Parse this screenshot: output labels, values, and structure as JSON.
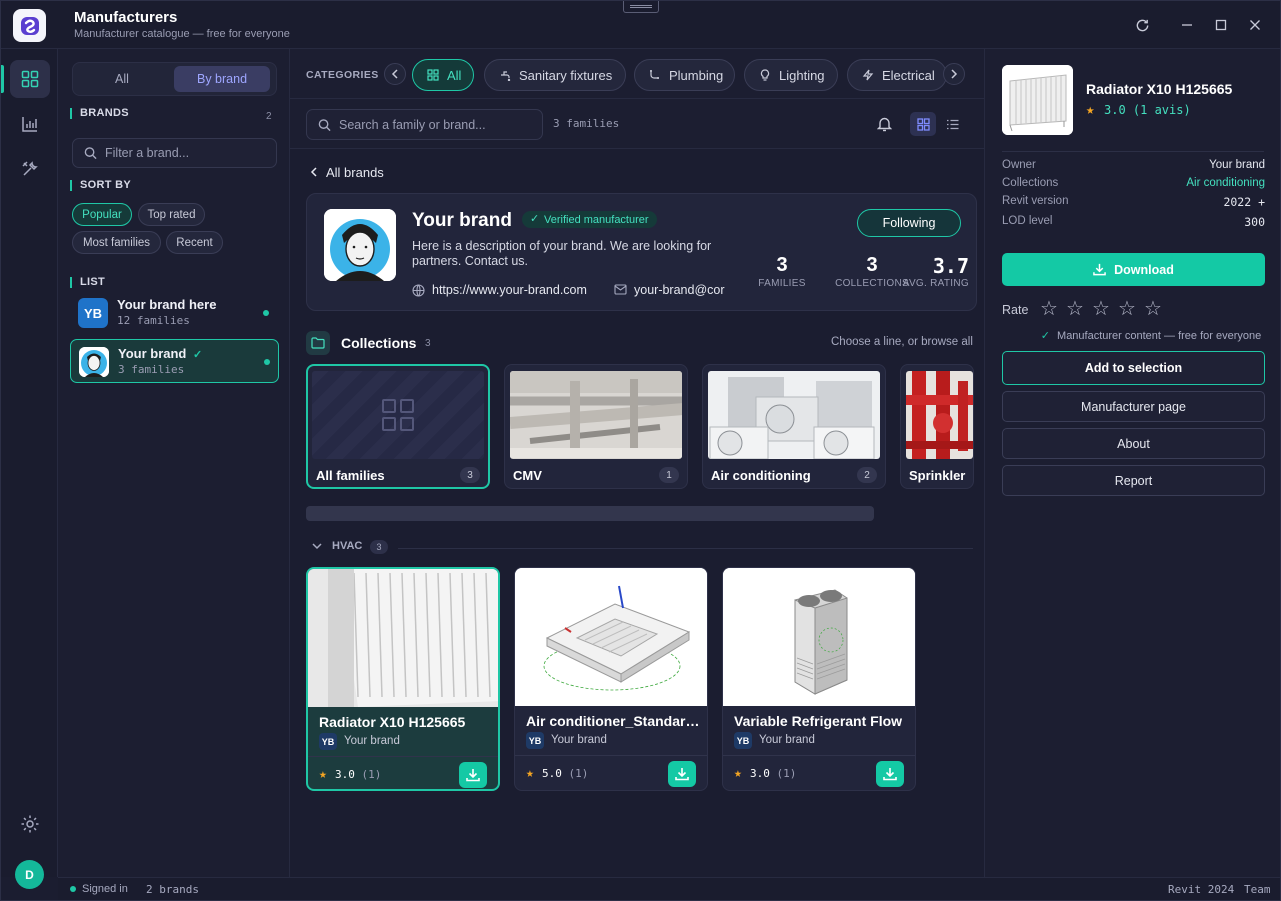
{
  "window": {
    "title": "Manufacturers",
    "subtitle": "Manufacturer catalogue — free for everyone"
  },
  "rail": {
    "items": [
      "grid-icon",
      "chart-icon",
      "tools-icon"
    ],
    "settings_icon": "gear-icon",
    "user_initial": "D"
  },
  "sidebar": {
    "segment": {
      "all": "All",
      "by_brand": "By brand",
      "selected": "By brand"
    },
    "brands_title": "BRANDS",
    "brands_count": "2",
    "filter_placeholder": "Filter a brand...",
    "sort_title": "SORT BY",
    "sort_options": [
      "Popular",
      "Top rated",
      "Most families",
      "Recent"
    ],
    "sort_selected": "Popular",
    "list_title": "LIST",
    "brands": [
      {
        "badge": "YB",
        "name": "Your brand here",
        "count": "12 families",
        "selected": false
      },
      {
        "badge": "",
        "name": "Your brand",
        "count": "3 families",
        "selected": true,
        "verified": true
      }
    ]
  },
  "categories": {
    "label": "CATEGORIES",
    "items": [
      {
        "label": "All",
        "icon": "grid-icon",
        "selected": true
      },
      {
        "label": "Sanitary fixtures",
        "icon": "faucet-icon"
      },
      {
        "label": "Plumbing",
        "icon": "pipe-icon"
      },
      {
        "label": "Lighting",
        "icon": "bulb-icon"
      },
      {
        "label": "Electrical",
        "icon": "bolt-icon"
      }
    ]
  },
  "toolbar": {
    "search_placeholder": "Search a family or brand...",
    "family_count": "3 families",
    "view_mode": "grid"
  },
  "brand_page": {
    "back_label": "All brands",
    "name": "Your brand",
    "verified_label": "Verified manufacturer",
    "description": "Here is a description of your brand. We are looking for partners. Contact us.",
    "follow_label": "Following",
    "website": "https://www.your-brand.com",
    "email": "your-brand@cor",
    "stats": [
      {
        "value": "3",
        "label": "FAMILIES"
      },
      {
        "value": "3",
        "label": "COLLECTIONS"
      },
      {
        "value": "3.7",
        "label": "AVG. RATING"
      }
    ]
  },
  "collections": {
    "title": "Collections",
    "count": "3",
    "hint": "Choose a line, or browse all",
    "items": [
      {
        "name": "All families",
        "count": "3",
        "selected": true
      },
      {
        "name": "CMV",
        "count": "1"
      },
      {
        "name": "Air conditioning",
        "count": "2"
      },
      {
        "name": "Sprinkler",
        "count": ""
      }
    ]
  },
  "group": {
    "title": "HVAC",
    "count": "3"
  },
  "products": [
    {
      "name": "Radiator X10 H125665",
      "brand_badge": "YB",
      "brand": "Your brand",
      "rating": "3.0",
      "reviews": "(1)",
      "selected": true
    },
    {
      "name": "Air conditioner_Standard...",
      "brand_badge": "YB",
      "brand": "Your brand",
      "rating": "5.0",
      "reviews": "(1)"
    },
    {
      "name": "Variable Refrigerant Flow",
      "brand_badge": "YB",
      "brand": "Your brand",
      "rating": "3.0",
      "reviews": "(1)"
    }
  ],
  "panel": {
    "title": "Radiator X10 H125665",
    "rating": "3.0 (1 avis)",
    "details": [
      {
        "key": "Owner",
        "value": "Your brand"
      },
      {
        "key": "Collections",
        "value": "Air conditioning"
      },
      {
        "key": "Revit version",
        "value": "2022 +"
      },
      {
        "key": "LOD level",
        "value": "300"
      }
    ],
    "download_label": "Download",
    "rate_label": "Rate",
    "user_rating": 0,
    "free_note": "Manufacturer content — free for everyone",
    "add_selection_label": "Add to selection",
    "manufacturer_page_label": "Manufacturer page",
    "about_label": "About",
    "report_label": "Report"
  },
  "status": {
    "signed_in": "Signed in",
    "brands": "2 brands",
    "revit": "Revit 2024",
    "team": "Team"
  },
  "colors": {
    "accent": "#1fc7a6",
    "background": "#1b1d30",
    "star": "#f5a623"
  }
}
